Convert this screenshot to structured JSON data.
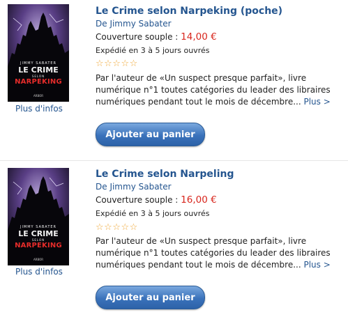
{
  "colors": {
    "link": "#24558f",
    "price": "#d8261d",
    "button": "#3a72bb",
    "stars": "#f0a93a"
  },
  "products": [
    {
      "title": "Le Crime selon Narpeking (poche)",
      "author": "De Jimmy Sabater",
      "format_label": "Couverture souple :",
      "price": "14,00 €",
      "shipping": "Expédié en 3 à 5 jours ouvrés",
      "rating_stars": "☆☆☆☆☆",
      "description": "Par l'auteur de «Un suspect presque parfait», livre numérique n°1 toutes catégories du leader des libraires numériques pendant tout le mois de décembre...",
      "more_link": "Plus >",
      "more_info": "Plus d'infos",
      "cart_button": "Ajouter au panier",
      "cover": {
        "author": "JIMMY SABATER",
        "title_line1": "LE CRIME",
        "title_line2": "SELON",
        "title_line3": "NARPEKING",
        "publisher": "ARBOR"
      }
    },
    {
      "title": "Le Crime selon Narpeling",
      "author": "De Jimmy Sabater",
      "format_label": "Couverture souple :",
      "price": "16,00 €",
      "shipping": "Expédié en 3 à 5 jours ouvrés",
      "rating_stars": "☆☆☆☆☆",
      "description": "Par l'auteur de «Un suspect presque parfait», livre numérique n°1 toutes catégories du leader des libraires numériques pendant tout le mois de décembre...",
      "more_link": "Plus >",
      "more_info": "Plus d'infos",
      "cart_button": "Ajouter au panier",
      "cover": {
        "author": "JIMMY SABATER",
        "title_line1": "LE CRIME",
        "title_line2": "SELON",
        "title_line3": "NARPEKING",
        "publisher": "ARBOR"
      }
    }
  ]
}
